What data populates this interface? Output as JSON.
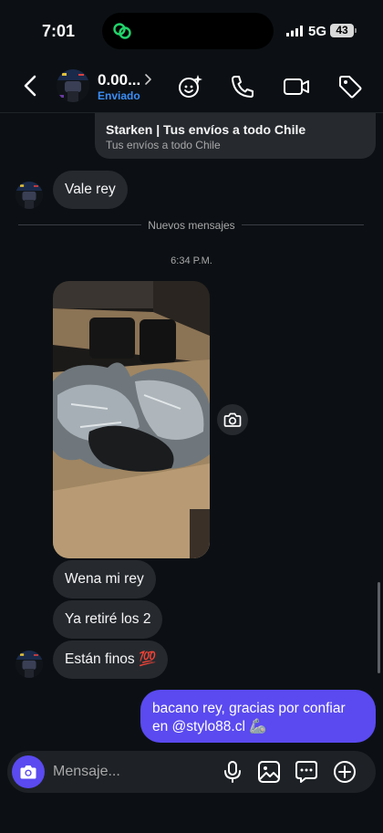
{
  "status_bar": {
    "time": "7:01",
    "network": "5G",
    "battery": "43"
  },
  "header": {
    "name": "0.00...",
    "subtitle": "Enviado"
  },
  "shared_card": {
    "title": "Starken | Tus envíos a todo Chile",
    "subtitle": "Tus envíos a todo Chile"
  },
  "messages": {
    "received_1": "Vale rey",
    "divider": "Nuevos mensajes",
    "timestamp": "6:34 P.M.",
    "received_2": "Wena mi rey",
    "received_3": "Ya retiré los 2",
    "received_4": "Están finos 💯",
    "sent_1": "bacano rey, gracias por confiar en @stylo88.cl 🦾"
  },
  "composer": {
    "placeholder": "Mensaje..."
  },
  "colors": {
    "background": "#0c1014",
    "bubble_received": "#262a2f",
    "bubble_sent": "#5a4af0",
    "accent_blue": "#3b8ef7"
  },
  "icons": [
    "phone-link-icon",
    "back-chevron-icon",
    "chevron-right-icon",
    "effects-icon",
    "phone-icon",
    "video-icon",
    "tag-icon",
    "camera-icon",
    "microphone-icon",
    "gallery-icon",
    "sticker-icon",
    "plus-icon"
  ]
}
